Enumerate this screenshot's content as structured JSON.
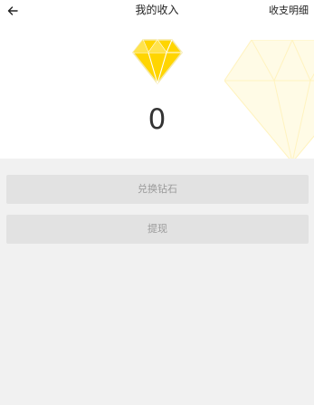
{
  "header": {
    "title": "我的收入",
    "right_link": "收支明细"
  },
  "income": {
    "balance": "0"
  },
  "actions": {
    "exchange_label": "兑换钻石",
    "withdraw_label": "提现"
  },
  "icons": {
    "back": "arrow-left-icon",
    "diamond": "diamond-icon"
  },
  "colors": {
    "diamond": "#ffd500",
    "button_bg": "#e2e2e2",
    "button_text": "#9a9a9a",
    "page_bg": "#f1f1f1"
  }
}
